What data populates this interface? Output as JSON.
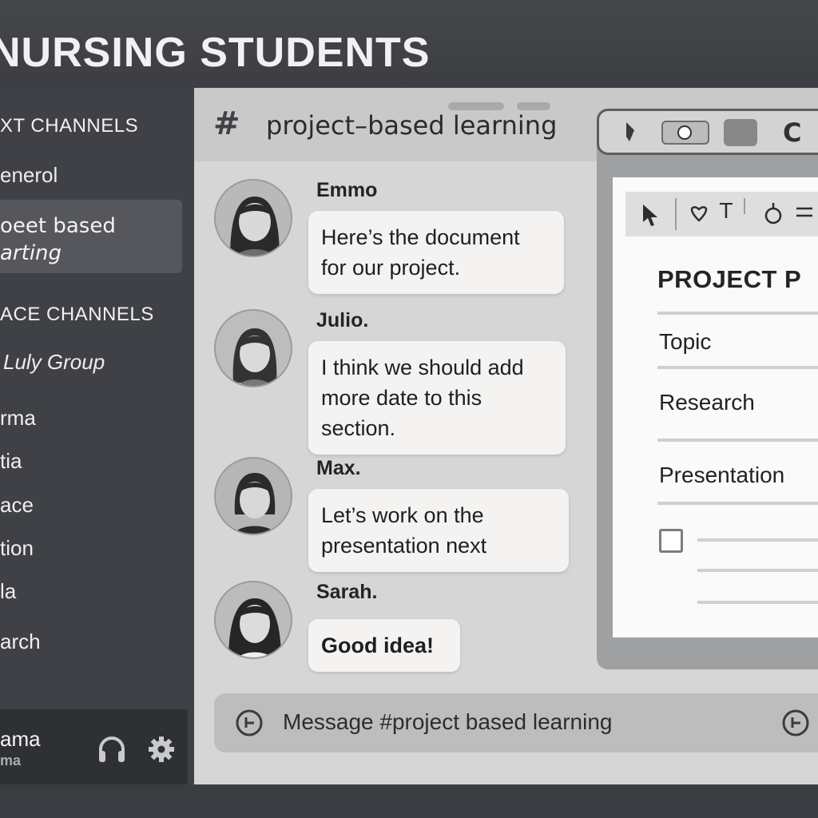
{
  "server": {
    "title": "NURSING STUDENTS"
  },
  "sidebar": {
    "text_category": "XT CHANNELS",
    "general": "enerol",
    "active_line1": "oeet based",
    "active_line2": "arting",
    "voice_category": "ACE CHANNELS",
    "study_group": "Luly Group",
    "members": [
      "rma",
      "tia",
      "ace",
      "tion",
      "la",
      "arch"
    ]
  },
  "user_panel": {
    "name": "ama",
    "status": "ma"
  },
  "channel": {
    "hash": "#",
    "name": "project–based learning"
  },
  "messages": [
    {
      "author": "Emmo",
      "lines": [
        "Here’s the document",
        "for our project."
      ]
    },
    {
      "author": "Julio.",
      "lines": [
        "I think we should add",
        "more date to this",
        "section."
      ]
    },
    {
      "author": "Max.",
      "lines": [
        "Let’s work on the",
        "presentation next"
      ]
    },
    {
      "author": "Sarah.",
      "lines": [
        "Good idea!"
      ]
    }
  ],
  "composer": {
    "placeholder": "Message #project based learning"
  },
  "document": {
    "title": "PROJECT P",
    "sections": [
      "Topic",
      "Research",
      "Presentation"
    ]
  },
  "icons": {
    "hash": "hash-icon",
    "headphones": "headphones-icon",
    "settings": "gear-icon",
    "add": "add-circle-icon",
    "cursor": "cursor-icon",
    "shield": "shield-icon",
    "text": "text-icon",
    "pen": "pen-icon",
    "menu": "menu-icon"
  }
}
